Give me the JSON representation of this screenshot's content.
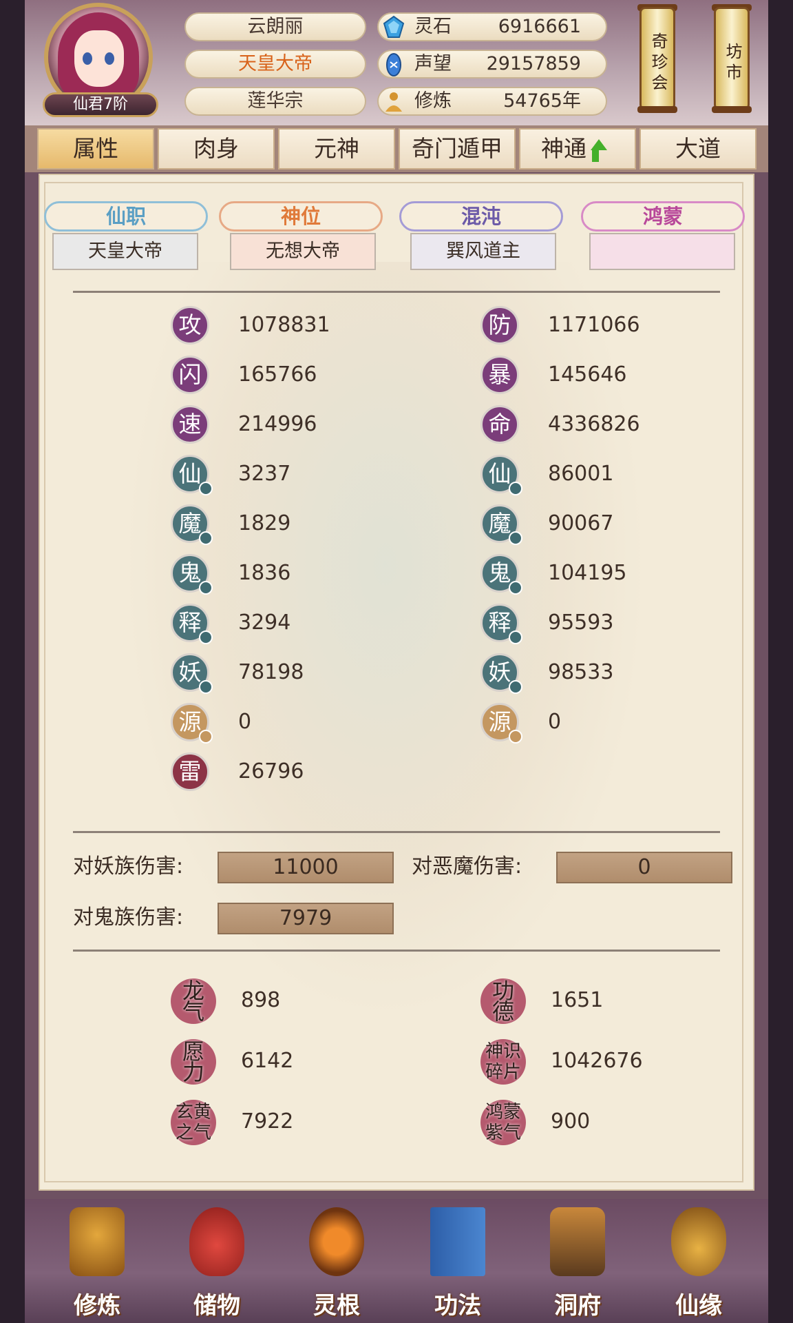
{
  "header": {
    "rank_badge": "仙君7阶",
    "pills": [
      "云朗丽",
      "天皇大帝",
      "莲华宗"
    ],
    "resources": [
      {
        "icon": "spirit-stone-icon",
        "label": "灵石",
        "value": "6916661"
      },
      {
        "icon": "prestige-icon",
        "label": "声望",
        "value": "29157859"
      },
      {
        "icon": "cultivation-icon",
        "label": "修炼",
        "value": "54765年"
      }
    ],
    "scroll_buttons": [
      "奇珍会",
      "坊市"
    ]
  },
  "tabs": [
    "属性",
    "肉身",
    "元神",
    "奇门遁甲",
    "神通",
    "大道"
  ],
  "rank_tabs": [
    {
      "title": "仙职",
      "value": "天皇大帝",
      "color": "#5a9fc4"
    },
    {
      "title": "神位",
      "value": "无想大帝",
      "color": "#e07a3a"
    },
    {
      "title": "混沌",
      "value": "巽风道主",
      "color": "#6c5aa8"
    },
    {
      "title": "鸿蒙",
      "value": "",
      "color": "#b8489a"
    }
  ],
  "stats_left": [
    {
      "label": "攻",
      "value": "1078831"
    },
    {
      "label": "闪",
      "value": "165766"
    },
    {
      "label": "速",
      "value": "214996"
    },
    {
      "label": "仙",
      "value": "3237"
    },
    {
      "label": "魔",
      "value": "1829"
    },
    {
      "label": "鬼",
      "value": "1836"
    },
    {
      "label": "释",
      "value": "3294"
    },
    {
      "label": "妖",
      "value": "78198"
    },
    {
      "label": "源",
      "value": "0"
    },
    {
      "label": "雷",
      "value": "26796"
    }
  ],
  "stats_right": [
    {
      "label": "防",
      "value": "1171066"
    },
    {
      "label": "暴",
      "value": "145646"
    },
    {
      "label": "命",
      "value": "4336826"
    },
    {
      "label": "仙",
      "value": "86001"
    },
    {
      "label": "魔",
      "value": "90067"
    },
    {
      "label": "鬼",
      "value": "104195"
    },
    {
      "label": "释",
      "value": "95593"
    },
    {
      "label": "妖",
      "value": "98533"
    },
    {
      "label": "源",
      "value": "0"
    }
  ],
  "damage": {
    "demon_race_label": "对妖族伤害:",
    "demon_race_value": "11000",
    "evil_demon_label": "对恶魔伤害:",
    "evil_demon_value": "0",
    "ghost_race_label": "对鬼族伤害:",
    "ghost_race_value": "7979"
  },
  "resources": [
    {
      "label": "龙气",
      "value": "898"
    },
    {
      "label": "功德",
      "value": "1651"
    },
    {
      "label": "愿力",
      "value": "6142"
    },
    {
      "label": "神识碎片",
      "value": "1042676"
    },
    {
      "label": "玄黄之气",
      "value": "7922"
    },
    {
      "label": "鸿蒙紫气",
      "value": "900"
    }
  ],
  "bottom_nav": [
    "修炼",
    "储物",
    "灵根",
    "功法",
    "洞府",
    "仙缘"
  ]
}
